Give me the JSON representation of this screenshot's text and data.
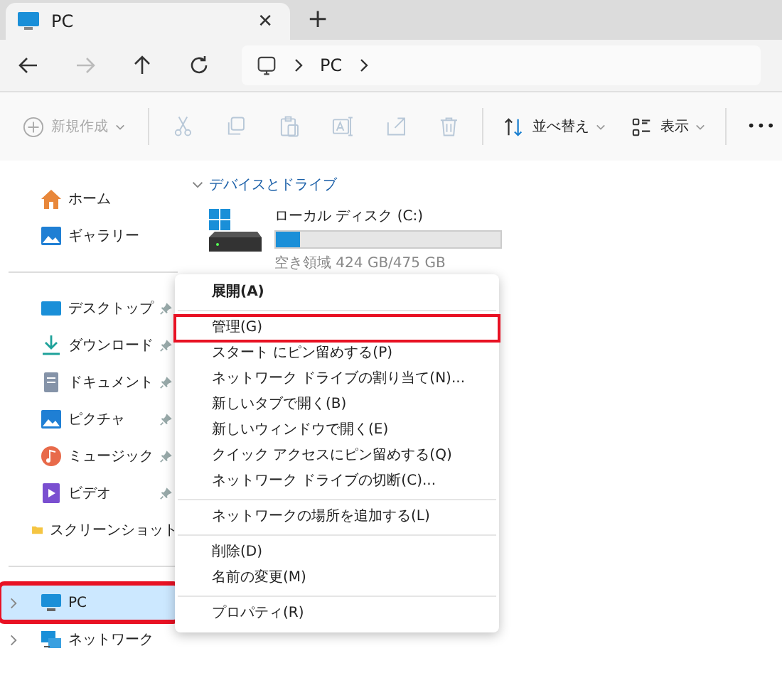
{
  "tab": {
    "title": "PC",
    "close": "✕",
    "new_tab": "+"
  },
  "nav": [
    {
      "kind": "back",
      "disabled": false
    },
    {
      "kind": "forward",
      "disabled": true
    },
    {
      "kind": "up",
      "disabled": false
    },
    {
      "kind": "refresh",
      "disabled": false
    }
  ],
  "address": {
    "crumbs": [
      "PC"
    ]
  },
  "toolbar": {
    "new_button": {
      "label": "新規作成",
      "disabled": true
    },
    "icon_buttons": [
      {
        "kind": "cut",
        "disabled": true
      },
      {
        "kind": "copy",
        "disabled": true
      },
      {
        "kind": "paste",
        "disabled": true
      },
      {
        "kind": "rename",
        "disabled": true
      },
      {
        "kind": "share",
        "disabled": true
      },
      {
        "kind": "delete",
        "disabled": true
      }
    ],
    "sort": {
      "label": "並べ替え"
    },
    "view": {
      "label": "表示"
    },
    "more": "•••"
  },
  "sidebar": {
    "groups": [
      [
        {
          "label": "ホーム",
          "kind": "home",
          "pinned": false,
          "selected": false,
          "highlighted": false
        },
        {
          "label": "ギャラリー",
          "kind": "gallery",
          "pinned": false,
          "selected": false,
          "highlighted": false
        }
      ],
      [
        {
          "label": "デスクトップ",
          "kind": "desktop",
          "pinned": true,
          "selected": false,
          "highlighted": false
        },
        {
          "label": "ダウンロード",
          "kind": "download",
          "pinned": true,
          "selected": false,
          "highlighted": false
        },
        {
          "label": "ドキュメント",
          "kind": "document",
          "pinned": true,
          "selected": false,
          "highlighted": false
        },
        {
          "label": "ピクチャ",
          "kind": "gallery",
          "pinned": true,
          "selected": false,
          "highlighted": false
        },
        {
          "label": "ミュージック",
          "kind": "music",
          "pinned": true,
          "selected": false,
          "highlighted": false
        },
        {
          "label": "ビデオ",
          "kind": "video",
          "pinned": true,
          "selected": false,
          "highlighted": false
        },
        {
          "label": "スクリーンショット",
          "kind": "folder",
          "pinned": false,
          "selected": false,
          "highlighted": false
        }
      ],
      [
        {
          "label": "PC",
          "kind": "pc",
          "expandable": true,
          "pinned": false,
          "selected": true,
          "highlighted": true
        },
        {
          "label": "ネットワーク",
          "kind": "network",
          "expandable": true,
          "pinned": false,
          "selected": false,
          "highlighted": false
        }
      ]
    ]
  },
  "section": {
    "title": "デバイスとドライブ",
    "expanded": true
  },
  "drive": {
    "name": "ローカル ディスク (C:)",
    "level": 0.11,
    "free": "空き領域 424 GB/475 GB"
  },
  "menu": {
    "groups": [
      [
        {
          "label": "展開(A)",
          "bold": true,
          "highlighted": false
        }
      ],
      [
        {
          "label": "管理(G)",
          "bold": false,
          "highlighted": true
        },
        {
          "label": "スタート にピン留めする(P)",
          "bold": false,
          "highlighted": false
        },
        {
          "label": "ネットワーク ドライブの割り当て(N)...",
          "bold": false,
          "highlighted": false
        },
        {
          "label": "新しいタブで開く(B)",
          "bold": false,
          "highlighted": false
        },
        {
          "label": "新しいウィンドウで開く(E)",
          "bold": false,
          "highlighted": false
        },
        {
          "label": "クイック アクセスにピン留めする(Q)",
          "bold": false,
          "highlighted": false
        },
        {
          "label": "ネットワーク ドライブの切断(C)...",
          "bold": false,
          "highlighted": false
        }
      ],
      [
        {
          "label": "ネットワークの場所を追加する(L)",
          "bold": false,
          "highlighted": false
        }
      ],
      [
        {
          "label": "削除(D)",
          "bold": false,
          "highlighted": false
        },
        {
          "label": "名前の変更(M)",
          "bold": false,
          "highlighted": false
        }
      ],
      [
        {
          "label": "プロパティ(R)",
          "bold": false,
          "highlighted": false
        }
      ]
    ]
  }
}
